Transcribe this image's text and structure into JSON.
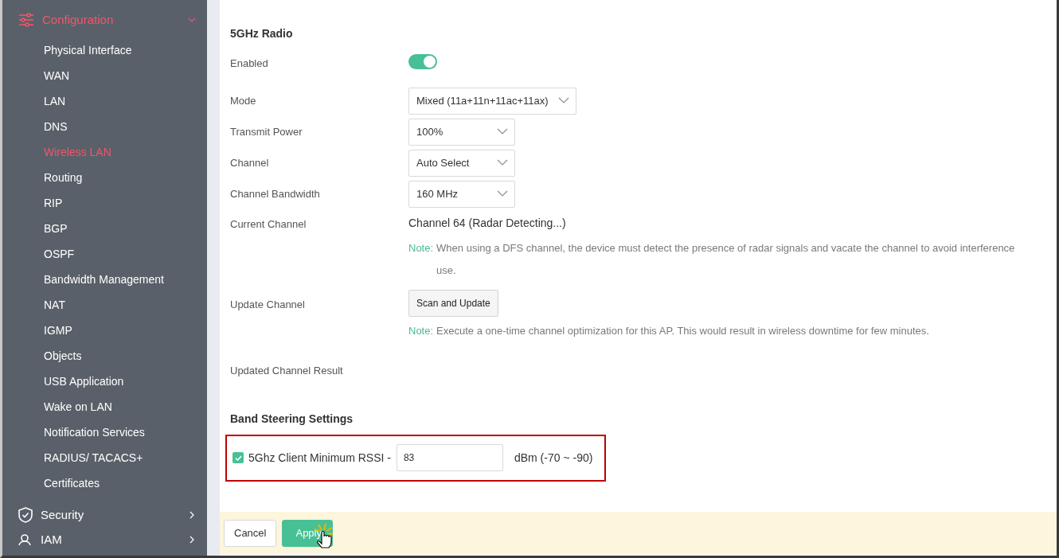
{
  "sidebar": {
    "sections": [
      {
        "label": "Configuration",
        "expanded": true,
        "selected": true,
        "items": [
          {
            "label": "Physical Interface",
            "selected": false
          },
          {
            "label": "WAN",
            "selected": false
          },
          {
            "label": "LAN",
            "selected": false
          },
          {
            "label": "DNS",
            "selected": false
          },
          {
            "label": "Wireless LAN",
            "selected": true
          },
          {
            "label": "Routing",
            "selected": false
          },
          {
            "label": "RIP",
            "selected": false
          },
          {
            "label": "BGP",
            "selected": false
          },
          {
            "label": "OSPF",
            "selected": false
          },
          {
            "label": "Bandwidth Management",
            "selected": false
          },
          {
            "label": "NAT",
            "selected": false
          },
          {
            "label": "IGMP",
            "selected": false
          },
          {
            "label": "Objects",
            "selected": false
          },
          {
            "label": "USB Application",
            "selected": false
          },
          {
            "label": "Wake on LAN",
            "selected": false
          },
          {
            "label": "Notification Services",
            "selected": false
          },
          {
            "label": "RADIUS/ TACACS+",
            "selected": false
          },
          {
            "label": "Certificates",
            "selected": false
          }
        ]
      },
      {
        "label": "Security",
        "expanded": false,
        "selected": false
      },
      {
        "label": "IAM",
        "expanded": false,
        "selected": false
      }
    ]
  },
  "radio": {
    "title": "5GHz Radio",
    "rows": [
      {
        "kind": "toggle",
        "label": "Enabled",
        "on": true
      },
      {
        "kind": "select",
        "label": "Mode",
        "value": "Mixed (11a+11n+11ac+11ax)"
      },
      {
        "kind": "select",
        "label": "Transmit Power",
        "value": "100%"
      },
      {
        "kind": "select",
        "label": "Channel",
        "value": "Auto Select"
      },
      {
        "kind": "select",
        "label": "Channel Bandwidth",
        "value": "160 MHz"
      },
      {
        "kind": "text",
        "label": "Current Channel",
        "value": "Channel 64 (Radar Detecting...)",
        "note_label": "Note:",
        "note_lines": [
          "When using a DFS channel, the device must detect the presence of radar signals and vacate the channel to avoid interference",
          "use."
        ]
      },
      {
        "kind": "button",
        "label": "Update Channel",
        "button": "Scan and Update",
        "note_label": "Note:",
        "note_lines": [
          "Execute a one-time channel optimization for this AP. This would result in wireless downtime for few minutes."
        ]
      },
      {
        "kind": "text",
        "label": "Updated Channel Result"
      }
    ]
  },
  "band_steering": {
    "title": "Band Steering Settings",
    "checked": true,
    "label": "5Ghz Client Minimum RSSI -",
    "value": "83",
    "unit": "dBm (-70 ~ -90)"
  },
  "footer": {
    "buttons": [
      {
        "label": "Cancel",
        "kind": "secondary"
      },
      {
        "label": "Apply",
        "kind": "primary"
      }
    ]
  }
}
